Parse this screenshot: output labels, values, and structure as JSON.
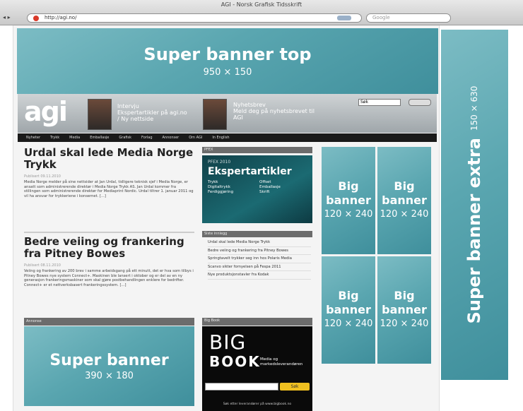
{
  "browser": {
    "window_title": "AGI - Norsk Grafisk Tidsskrift",
    "url": "http://agi.no/",
    "search_placeholder": "Google"
  },
  "site": {
    "logo_text": "agi",
    "promo_1": {
      "label": "Intervju",
      "text": "Ekspertartikler på agi.no / Ny nettside"
    },
    "promo_2": {
      "label": "Nyhetsbrev",
      "text": "Meld deg på nyhetsbrevet til AGI"
    },
    "search_value": "Søk",
    "search_button": "Søk",
    "nav": [
      "Nyheter",
      "Trykk",
      "Media",
      "Emballasje",
      "Grafisk",
      "Forlag",
      "Annonser",
      "Om AGI",
      "In English"
    ]
  },
  "articles": [
    {
      "headline": "Urdal skal lede Media Norge Trykk",
      "meta": "Publisert 09.11.2010",
      "body": "Media Norge melder på sine nettsider at Jan Urdal, tidligere teknisk sjef i Media Norge, er ansatt som administrerende direktør i Media Norge Trykk AS. Jan Urdal kommer fra stillingen som administrerende direktør for Mediaprint Nordic. Urdal tiltrer 1. januar 2011 og vil ha ansvar for trykkeriene i konsernet. [...]"
    },
    {
      "headline": "Bedre veiing og frankering fra Pitney Bowes",
      "meta": "Publisert 08.11.2010",
      "body": "Veiing og frankering av 200 brev i samme arbeidsgang på ett minutt, det er hva som tilbys i Pitney Bowes nye system Connect+. Maskinen ble lansert i oktober og er del av en ny generasjon frankeringsmaskiner som skal gjøre postbehandlingen enklere for bedrifter. Connect+ er et nettverksbasert frankeringssystem. [...]"
    }
  ],
  "sidebar": {
    "expert_head": "PFEX",
    "expert_title": "Ekspertartikler",
    "expert_year": "PFEX 2010",
    "expert_items": [
      "Trykk",
      "Digitaltrykk",
      "Ferdiggjøring",
      "Offset",
      "Emballasje",
      "Skrift"
    ],
    "recent_head": "Siste innlegg",
    "recent_items": [
      "Urdal skal lede Media Norge Trykk",
      "Bedre veiing og frankering fra Pitney Bowes",
      "Springtavelt trykker seg inn hos Polaris Media",
      "Scanvo sikter fornyelsen på Fespa 2011",
      "Nye produktsjonstavler fra Kodak"
    ],
    "adv_head": "Annonse",
    "book_head": "Big Book",
    "book_title_1": "BIG",
    "book_title_2": "BOOK",
    "book_tagline": "Media og markedsleverandøren",
    "book_button": "Søk",
    "book_footer": "Søk etter leverandører på www.bigbook.no"
  },
  "ads": {
    "super_top": {
      "title": "Super banner top",
      "dims": "950 × 150"
    },
    "super_extra": {
      "title": "Super banner extra",
      "dims": "150 × 630"
    },
    "big_banners": [
      {
        "title_1": "Big",
        "title_2": "banner",
        "dims": "120 × 240"
      },
      {
        "title_1": "Big",
        "title_2": "banner",
        "dims": "120 × 240"
      },
      {
        "title_1": "Big",
        "title_2": "banner",
        "dims": "120 × 240"
      },
      {
        "title_1": "Big",
        "title_2": "banner",
        "dims": "120 × 240"
      }
    ],
    "super_banner": {
      "title": "Super banner",
      "dims": "390 × 180"
    }
  },
  "colors": {
    "banner_teal": "#5aa6b0",
    "nav_black": "#1a1a1a",
    "sidebar_head": "#6c6c6c",
    "book_search_yellow": "#f0c020"
  }
}
